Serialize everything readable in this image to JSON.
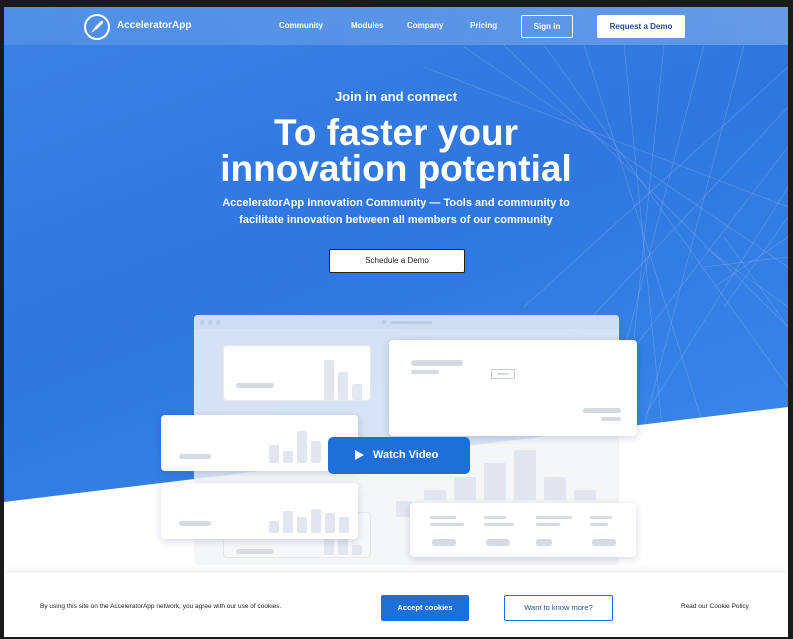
{
  "nav": {
    "brand": "AcceleratorApp",
    "links": [
      "Community",
      "Modules",
      "Company",
      "Pricing"
    ],
    "sign_in": "Sign in",
    "request_demo": "Request a Demo"
  },
  "hero": {
    "eyebrow": "Join in and connect",
    "title_line1": "To faster your",
    "title_line2": "innovation potential",
    "subtitle_line1": "AcceleratorApp Innovation Community — Tools and community to",
    "subtitle_line2": "facilitate innovation between all members of our community",
    "cta": "Schedule a Demo",
    "watch_video": "Watch Video"
  },
  "cookie": {
    "text": "By using this site on the AcceleratorApp network, you agree with our use of cookies.",
    "accept": "Accept cookies",
    "more": "Want to know more?",
    "policy": "Read our Cookie Policy"
  },
  "colors": {
    "hero_blue": "#2f77df",
    "button_blue": "#1f6fd8"
  }
}
